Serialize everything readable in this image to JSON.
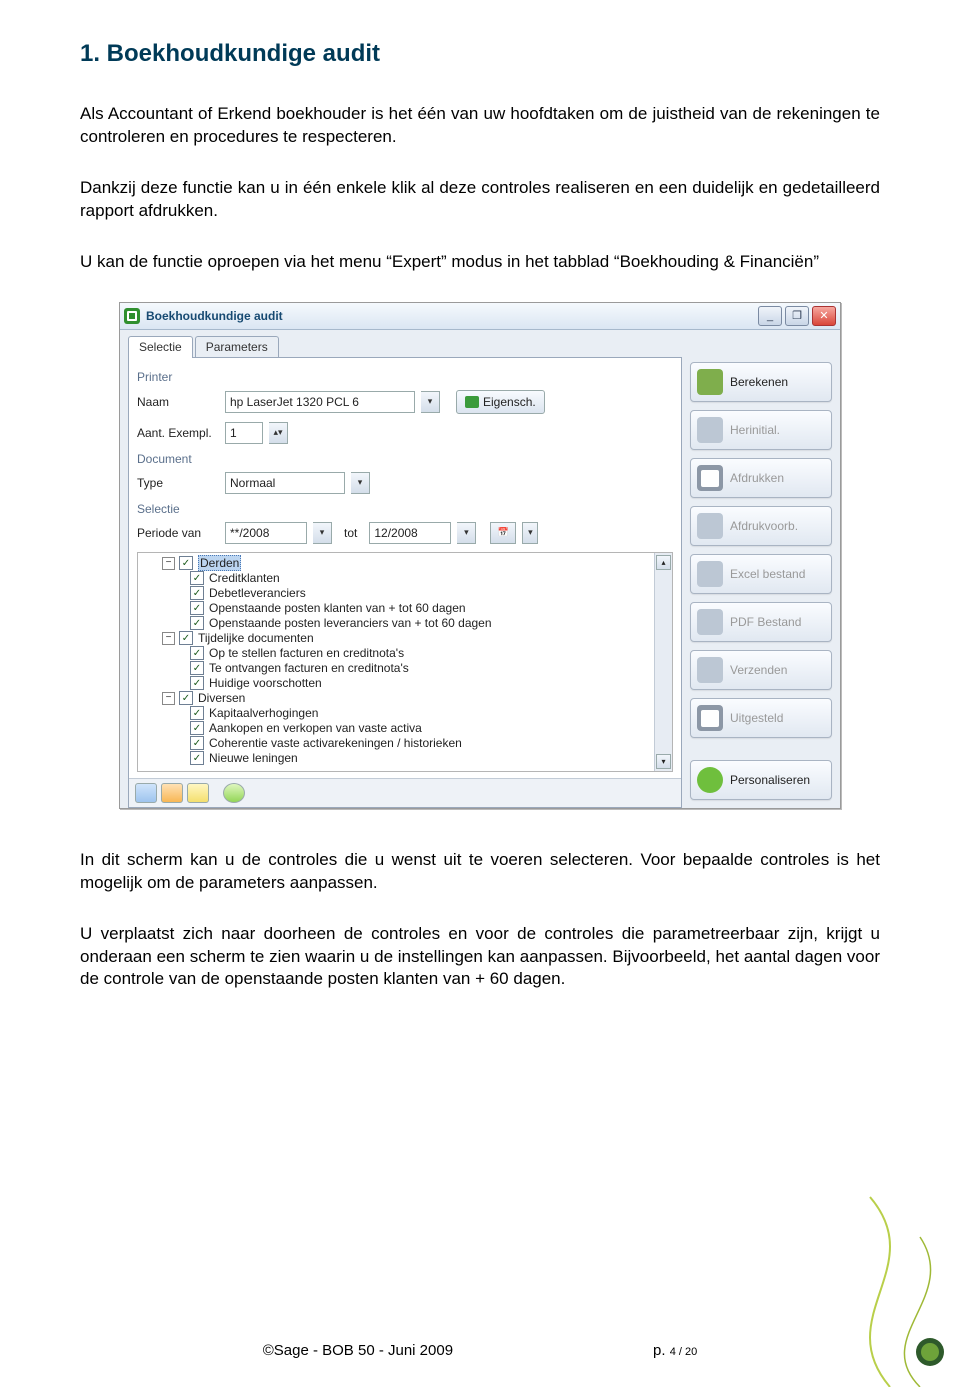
{
  "heading": "1. Boekhoudkundige audit",
  "p1": "Als Accountant of Erkend boekhouder is het één van uw hoofdtaken om de juistheid van de rekeningen te controleren en procedures te respecteren.",
  "p2": "Dankzij deze functie kan u in één enkele klik al deze controles realiseren en een duidelijk en gedetailleerd rapport afdrukken.",
  "p3": "U kan de functie oproepen via het menu “Expert” modus in het tabblad “Boekhouding & Financiën”",
  "p4": "In dit scherm kan u de controles die u wenst uit te voeren selecteren.  Voor bepaalde controles is het mogelijk om de parameters aanpassen.",
  "p5": "U verplaatst zich naar doorheen de controles en voor de controles die parametreerbaar zijn, krijgt u onderaan een scherm te zien waarin u de instellingen kan aanpassen.  Bijvoorbeeld, het aantal dagen voor de controle van de openstaande posten klanten van + 60 dagen.",
  "dialog": {
    "title": "Boekhoudkundige audit",
    "tabs": {
      "t1": "Selectie",
      "t2": "Parameters"
    },
    "sections": {
      "printer": "Printer",
      "document": "Document",
      "selectie": "Selectie"
    },
    "labels": {
      "naam": "Naam",
      "aant": "Aant. Exempl.",
      "type": "Type",
      "periode": "Periode van",
      "tot": "tot"
    },
    "values": {
      "printer": "hp LaserJet 1320 PCL 6",
      "exempl": "1",
      "type": "Normaal",
      "periode_from": "**/2008",
      "periode_to": "12/2008"
    },
    "buttons": {
      "eigensch": "Eigensch."
    },
    "tree": {
      "n0": "Derden",
      "n0_0": "Creditklanten",
      "n0_1": "Debetleveranciers",
      "n0_2": "Openstaande posten klanten van + tot 60 dagen",
      "n0_3": "Openstaande posten leveranciers van + tot 60 dagen",
      "n1": "Tijdelijke documenten",
      "n1_0": "Op te stellen facturen en creditnota's",
      "n1_1": "Te ontvangen facturen en creditnota's",
      "n1_2": "Huidige voorschotten",
      "n2": "Diversen",
      "n2_0": "Kapitaalverhogingen",
      "n2_1": "Aankopen en verkopen van vaste activa",
      "n2_2": "Coherentie vaste activarekeningen / historieken",
      "n2_3": "Nieuwe leningen"
    },
    "actions": {
      "berekenen": "Berekenen",
      "herinit": "Herinitial.",
      "afdrukken": "Afdrukken",
      "afdrukvoorb": "Afdrukvoorb.",
      "excel": "Excel bestand",
      "pdf": "PDF Bestand",
      "verzenden": "Verzenden",
      "uitgesteld": "Uitgesteld",
      "personaliseren": "Personaliseren"
    }
  },
  "footer": {
    "copyright": "©Sage - BOB 50 - Juni 2009",
    "page_prefix": "p. ",
    "page_num": "4 / 20"
  }
}
